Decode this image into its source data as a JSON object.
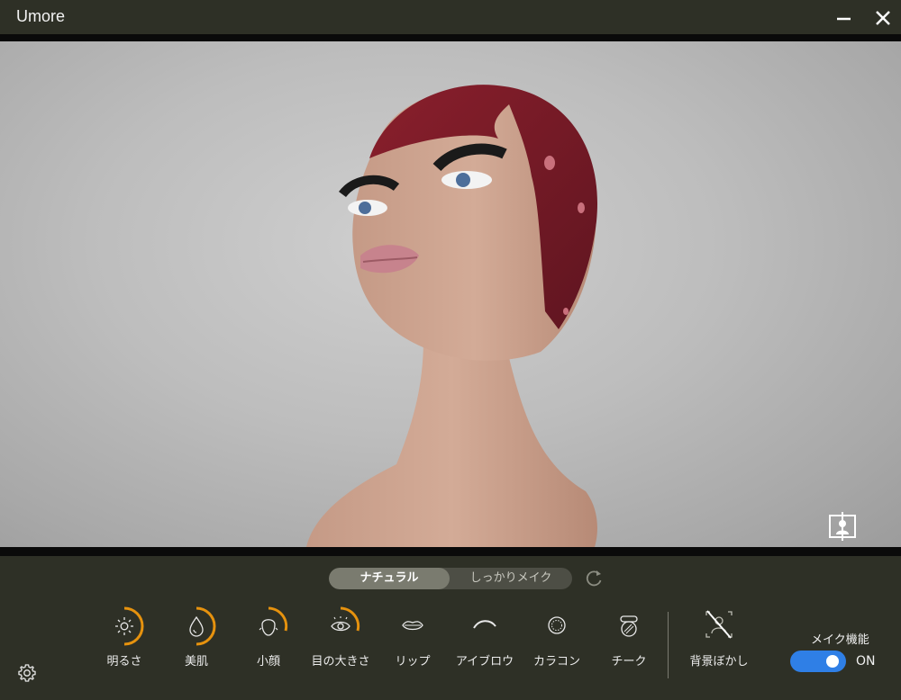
{
  "window": {
    "title": "Umore",
    "controls": [
      "minimize-icon",
      "close-icon"
    ]
  },
  "preview": {
    "camera_toggle_icon": "camera-flip-icon"
  },
  "modes": {
    "options": [
      "ナチュラル",
      "しっかりメイク"
    ],
    "selected": "ナチュラル",
    "reset_icon": "refresh-icon"
  },
  "tools": [
    {
      "label": "明るさ",
      "icon": "brightness-icon",
      "level": 0.5
    },
    {
      "label": "美肌",
      "icon": "skin-drop-icon",
      "level": 0.5
    },
    {
      "label": "小顔",
      "icon": "face-slim-icon",
      "level": 0.4
    },
    {
      "label": "目の大きさ",
      "icon": "eye-size-icon",
      "level": 0.4
    },
    {
      "label": "リップ",
      "icon": "lip-icon"
    },
    {
      "label": "アイブロウ",
      "icon": "eyebrow-icon"
    },
    {
      "label": "カラコン",
      "icon": "color-contact-icon"
    },
    {
      "label": "チーク",
      "icon": "cheek-icon"
    }
  ],
  "background_blur": {
    "label": "背景ぼかし",
    "icon": "background-blur-off-icon"
  },
  "makeup_feature": {
    "label": "メイク機能",
    "state": "ON"
  },
  "settings_icon": "gear-icon",
  "colors": {
    "background": "#2e3026",
    "accent_arc": "#e6920e",
    "toggle_on": "#2f7fe6"
  }
}
